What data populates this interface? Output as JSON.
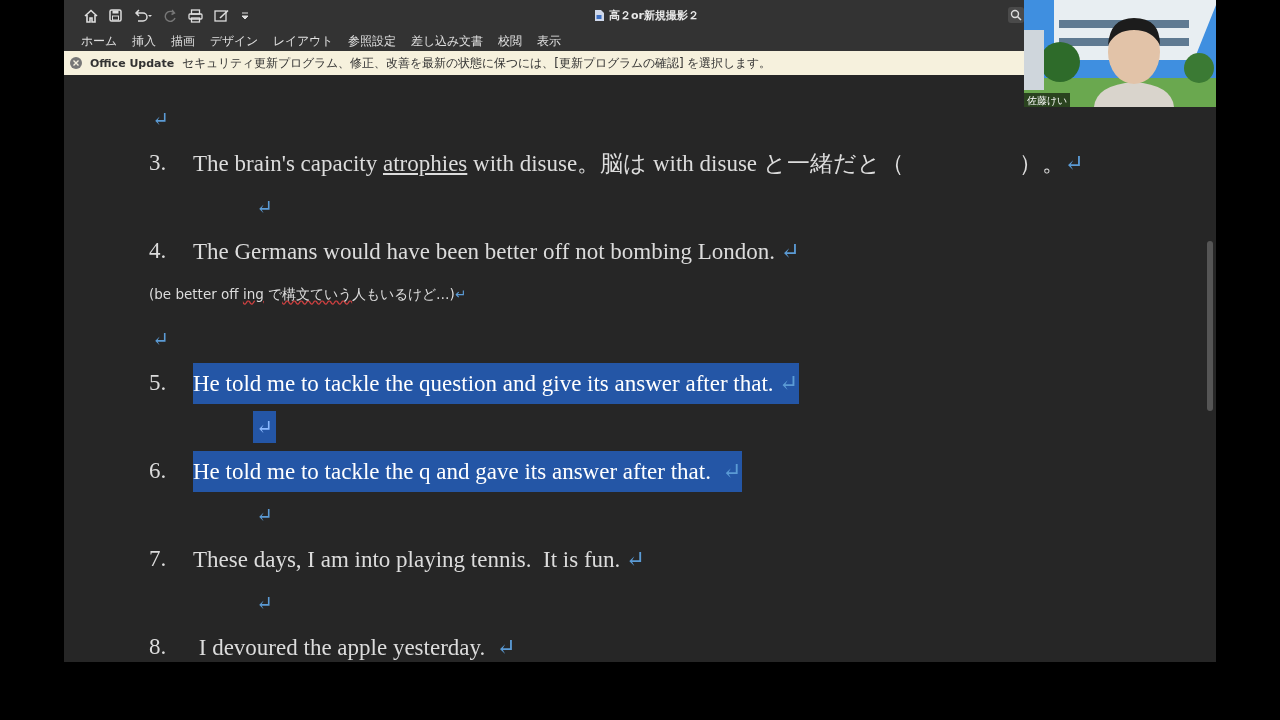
{
  "title_bar": {
    "title": "高２or新規撮影２"
  },
  "ribbon": {
    "tabs": [
      {
        "label": "ホーム"
      },
      {
        "label": "挿入"
      },
      {
        "label": "描画"
      },
      {
        "label": "デザイン"
      },
      {
        "label": "レイアウト"
      },
      {
        "label": "参照設定"
      },
      {
        "label": "差し込み文書"
      },
      {
        "label": "校閲"
      },
      {
        "label": "表示"
      }
    ]
  },
  "update_banner": {
    "title": "Office Update",
    "message": "セキュリティ更新プログラム、修正、改善を最新の状態に保つには、[更新プログラムの確認] を選択します。"
  },
  "video": {
    "name": "佐藤けい"
  },
  "document": {
    "lines": [
      {
        "kind": "mark",
        "mark": "↵",
        "selected": false
      },
      {
        "kind": "item",
        "number": "3.",
        "selected": false,
        "segments": [
          {
            "text": "The brain's capacity ",
            "underline": false
          },
          {
            "text": "atrophies",
            "underline": true
          },
          {
            "text": " with disuse。脳は with disuse と一緒だと（　　　　　）。",
            "underline": false
          }
        ],
        "mark": "↵"
      },
      {
        "kind": "indented_mark",
        "mark": "↵",
        "selected": false
      },
      {
        "kind": "item",
        "number": "4.",
        "selected": false,
        "segments": [
          {
            "text": "The Germans would have been better off not bombing London. ",
            "underline": false
          }
        ],
        "mark": "↵"
      },
      {
        "kind": "note",
        "segments": [
          {
            "text": "(be better off ",
            "spellcheck": false
          },
          {
            "text": "ing",
            "spellcheck": true
          },
          {
            "text": " で",
            "spellcheck": false
          },
          {
            "text": "構文ていう",
            "spellcheck": true
          },
          {
            "text": "人もいるけど…)",
            "spellcheck": false
          }
        ],
        "mark": "↵"
      },
      {
        "kind": "mark",
        "mark": "↵",
        "selected": false
      },
      {
        "kind": "item",
        "number": "5.",
        "selected": true,
        "segments": [
          {
            "text": "He told me to tackle the question and give its answer after that. ",
            "underline": false
          }
        ],
        "mark": "↵"
      },
      {
        "kind": "indented_mark",
        "mark": "↵",
        "selected": true
      },
      {
        "kind": "item",
        "number": "6.",
        "selected": true,
        "segments": [
          {
            "text": "He told me to tackle the q and gave its answer after that.  ",
            "underline": false
          }
        ],
        "mark": "↵"
      },
      {
        "kind": "indented_mark",
        "mark": "↵",
        "selected": false
      },
      {
        "kind": "item",
        "number": "7.",
        "selected": false,
        "segments": [
          {
            "text": "These days, I am into playing tennis.  It is fun. ",
            "underline": false
          }
        ],
        "mark": "↵"
      },
      {
        "kind": "indented_mark",
        "mark": "↵",
        "selected": false
      },
      {
        "kind": "item",
        "number": "8.",
        "selected": false,
        "segments": [
          {
            "text": " I devoured the apple yesterday.  ",
            "underline": false
          }
        ],
        "mark": "↵"
      }
    ]
  }
}
